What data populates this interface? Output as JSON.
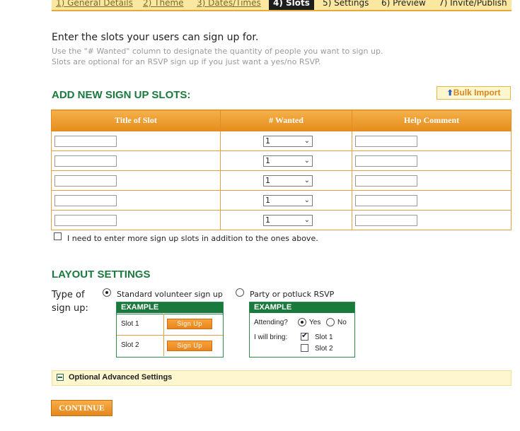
{
  "tabs": [
    {
      "label": "1) General Details",
      "state": "link"
    },
    {
      "label": "2) Theme",
      "state": "link"
    },
    {
      "label": "3) Dates/Times",
      "state": "link"
    },
    {
      "label": "4) Slots",
      "state": "active"
    },
    {
      "label": "5) Settings",
      "state": "plain"
    },
    {
      "label": "6) Preview",
      "state": "plain"
    },
    {
      "label": "7) Invite/Publish",
      "state": "plain"
    }
  ],
  "intro": {
    "text": "Enter the slots your users can sign up for.",
    "hint1": "Use the \"# Wanted\" column to designate the quantity of people you want to sign up.",
    "hint2": "Slots are optional for an RSVP sign up if you just want a yes/no RSVP."
  },
  "slots": {
    "heading": "ADD NEW SIGN UP SLOTS:",
    "bulk_import": "Bulk Import",
    "columns": [
      "Title of Slot",
      "# Wanted",
      "Help Comment"
    ],
    "rows": [
      {
        "title": "",
        "wanted": "1",
        "comment": ""
      },
      {
        "title": "",
        "wanted": "1",
        "comment": ""
      },
      {
        "title": "",
        "wanted": "1",
        "comment": ""
      },
      {
        "title": "",
        "wanted": "1",
        "comment": ""
      },
      {
        "title": "",
        "wanted": "1",
        "comment": ""
      }
    ],
    "more_label": "I need to enter more sign up slots in addition to the ones above."
  },
  "layout": {
    "heading": "LAYOUT SETTINGS",
    "type_label": "Type of sign up:",
    "option_standard": "Standard volunteer sign up",
    "option_party": "Party or potluck RSVP",
    "selected": "standard",
    "example_label": "EXAMPLE",
    "standard_example": {
      "slot1": "Slot 1",
      "slot2": "Slot 2",
      "button": "Sign Up"
    },
    "party_example": {
      "attending": "Attending?",
      "yes": "Yes",
      "no": "No",
      "bring": "I will bring:",
      "slot1": "Slot 1",
      "slot2": "Slot 2"
    }
  },
  "advanced": {
    "label": "Optional Advanced Settings"
  },
  "continue_label": "CONTINUE",
  "colors": {
    "accent_orange": "#e48d1c",
    "heading_green": "#1a7a3e",
    "tab_bar": "#fbe8a0"
  }
}
